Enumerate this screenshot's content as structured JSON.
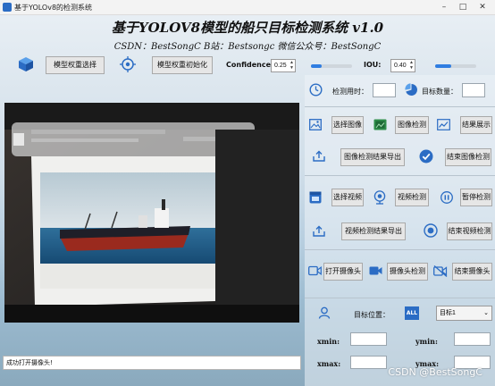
{
  "window": {
    "title": "基于YOLOv8的检测系统",
    "minimize": "–",
    "maximize": "□",
    "close": "✕"
  },
  "header": {
    "title": "基于YOLOV8模型的船只目标检测系统 v1.0",
    "subtitle": "CSDN：BestSongC    B站：Bestsongc    微信公众号：BestSongC"
  },
  "toolbar": {
    "select_weights": "模型权重选择",
    "init_weights": "模型权重初始化",
    "confidence_label": "Confidence:",
    "confidence_value": "0.25",
    "confidence_level": 0.25,
    "iou_label": "IOU:",
    "iou_value": "0.40",
    "iou_level": 0.4
  },
  "info": {
    "detect_time_label": "检测用时：",
    "detect_time_value": "",
    "target_count_label": "目标数量：",
    "target_count_value": ""
  },
  "image_section": {
    "select_image": "选择图像",
    "detect_image": "图像检测",
    "show_result": "结果展示",
    "export_image": "图像检测结果导出",
    "end_image": "结束图像检测"
  },
  "video_section": {
    "select_video": "选择视频",
    "detect_video": "视频检测",
    "pause_detect": "暂停检测",
    "export_video": "视频检测结果导出",
    "end_video": "结束视频检测"
  },
  "camera_section": {
    "open_camera": "打开摄像头",
    "camera_detect": "摄像头检测",
    "end_camera": "结束摄像头"
  },
  "target_section": {
    "position_label": "目标位置：",
    "all_badge": "ALL",
    "target_select": "目标1",
    "xmin_label": "xmin:",
    "ymin_label": "ymin:",
    "xmax_label": "xmax:",
    "ymax_label": "ymax:"
  },
  "status_bar": "成功打开摄像头!",
  "watermark": "CSDN @BestSongC",
  "colors": {
    "accent": "#2f7de1",
    "icon_blue": "#2b6cc4"
  }
}
